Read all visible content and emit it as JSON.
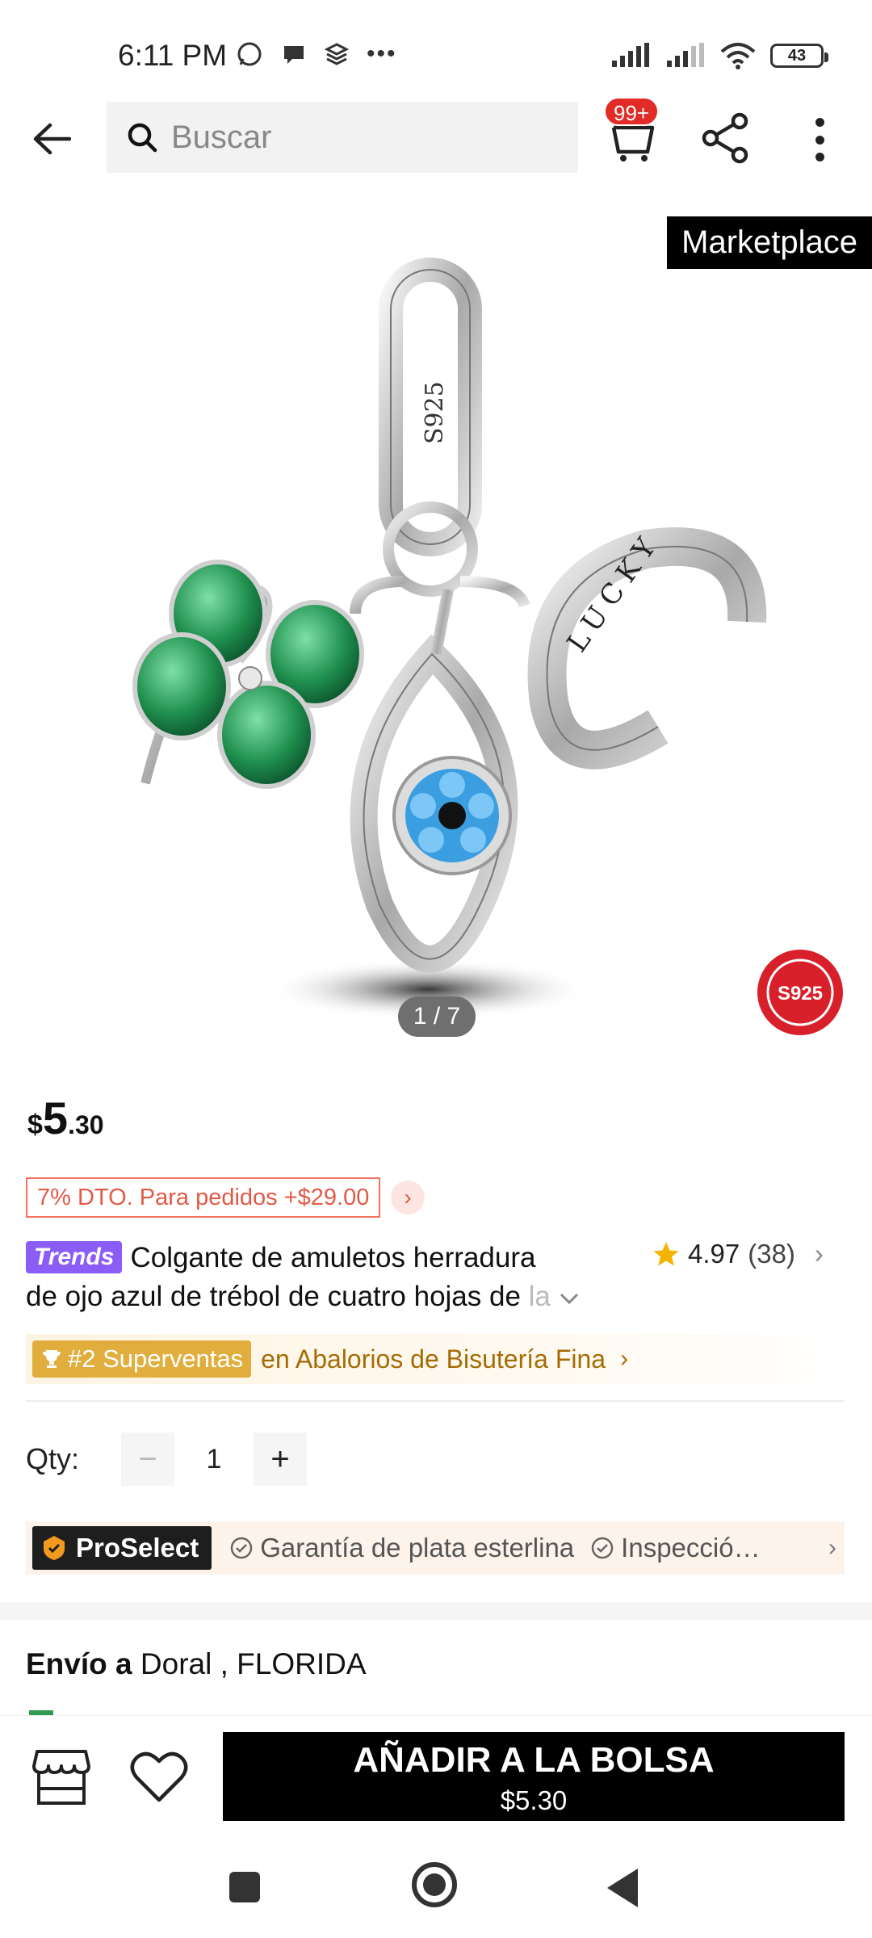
{
  "status_bar": {
    "time": "6:11 PM",
    "battery": "43"
  },
  "header": {
    "search_placeholder": "Buscar",
    "cart_badge": "99+"
  },
  "gallery": {
    "tag": "Marketplace",
    "pager": "1 / 7",
    "charm_engraving": "S925",
    "charm_text": "LUCKY",
    "seal_text": "S925"
  },
  "price": {
    "currency": "$",
    "integer": "5",
    "decimal": ".30"
  },
  "discount": {
    "label": "7% DTO. Para pedidos +$29.00"
  },
  "product": {
    "badge": "Trends",
    "title_line1": "Colgante de amuletos herradura",
    "title_line2": "de ojo azul de trébol de cuatro hojas de ",
    "title_fade": "la"
  },
  "rating": {
    "score": "4.97",
    "count": "(38)"
  },
  "rank": {
    "badge": "#2 Superventas",
    "category": "en Abalorios de Bisutería Fina"
  },
  "quantity": {
    "label": "Qty:",
    "value": "1",
    "minus": "−",
    "plus": "+"
  },
  "proselect": {
    "badge": "ProSelect",
    "items": [
      "Garantía de plata esterlina",
      "Inspecció…"
    ]
  },
  "shipping": {
    "label": "Envío a",
    "location": "Doral , FLORIDA"
  },
  "bottom_bar": {
    "add_label": "AÑADIR A LA BOLSA",
    "add_price": "$5.30"
  },
  "colors": {
    "accent_red": "#e02b27",
    "rank_gold": "#e1ad3c",
    "trends_purple": "#8b5cf6",
    "clover_green": "#1f8f4e",
    "eye_blue": "#3a9ee0"
  }
}
